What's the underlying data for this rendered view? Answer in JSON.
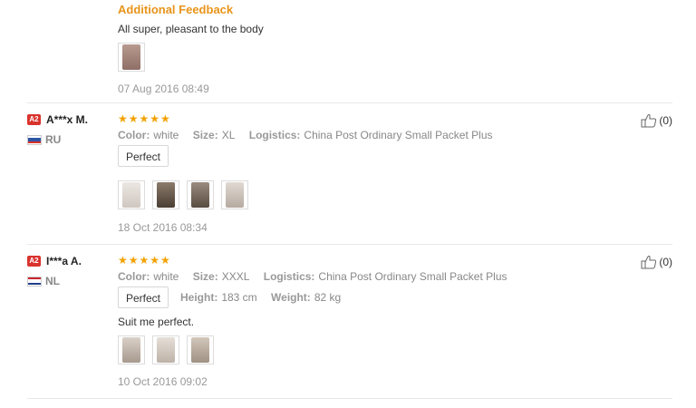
{
  "additional": {
    "title": "Additional Feedback",
    "text": "All super, pleasant to the body",
    "date": "07 Aug 2016 08:49"
  },
  "reviews": [
    {
      "level": "A2",
      "name": "A***x M.",
      "country": "RU",
      "color_label": "Color:",
      "color": "white",
      "size_label": "Size:",
      "size": "XL",
      "logistics_label": "Logistics:",
      "logistics": "China Post Ordinary Small Packet Plus",
      "tag": "Perfect",
      "date": "18 Oct 2016 08:34",
      "helpful": "(0)"
    },
    {
      "level": "A2",
      "name": "I***a A.",
      "country": "NL",
      "color_label": "Color:",
      "color": "white",
      "size_label": "Size:",
      "size": "XXXL",
      "logistics_label": "Logistics:",
      "logistics": "China Post Ordinary Small Packet Plus",
      "tag": "Perfect",
      "height_label": "Height:",
      "height": "183 cm",
      "weight_label": "Weight:",
      "weight": "82 kg",
      "comment": "Suit me perfect.",
      "date": "10 Oct 2016 09:02",
      "helpful": "(0)"
    }
  ],
  "stars": "★★★★★",
  "colors": {
    "accent": "#e8941a",
    "star": "#f2a200",
    "badge": "#d9332e"
  }
}
